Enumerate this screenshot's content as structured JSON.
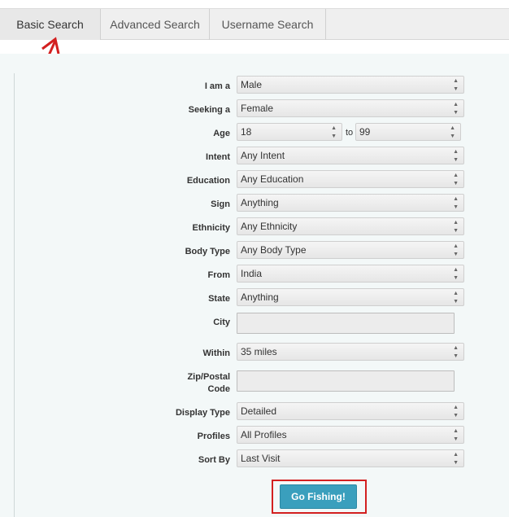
{
  "tabs": [
    {
      "label": "Basic Search"
    },
    {
      "label": "Advanced Search"
    },
    {
      "label": "Username Search"
    }
  ],
  "form": {
    "i_am_a": {
      "label": "I am a",
      "value": "Male"
    },
    "seeking": {
      "label": "Seeking a",
      "value": "Female"
    },
    "age": {
      "label": "Age",
      "min": "18",
      "to": "to",
      "max": "99"
    },
    "intent": {
      "label": "Intent",
      "value": "Any Intent"
    },
    "education": {
      "label": "Education",
      "value": "Any Education"
    },
    "sign": {
      "label": "Sign",
      "value": "Anything"
    },
    "ethnicity": {
      "label": "Ethnicity",
      "value": "Any Ethnicity"
    },
    "body_type": {
      "label": "Body Type",
      "value": "Any Body Type"
    },
    "from": {
      "label": "From",
      "value": "India"
    },
    "state": {
      "label": "State",
      "value": "Anything"
    },
    "city": {
      "label": "City",
      "value": ""
    },
    "within": {
      "label": "Within",
      "value": "35 miles"
    },
    "zip": {
      "label_line1": "Zip/Postal",
      "label_line2": "Code",
      "value": ""
    },
    "display_type": {
      "label": "Display Type",
      "value": "Detailed"
    },
    "profiles": {
      "label": "Profiles",
      "value": "All Profiles"
    },
    "sort_by": {
      "label": "Sort By",
      "value": "Last Visit"
    }
  },
  "submit_label": "Go Fishing!",
  "colors": {
    "button": "#3a9fbd",
    "annotation": "#d32020"
  }
}
